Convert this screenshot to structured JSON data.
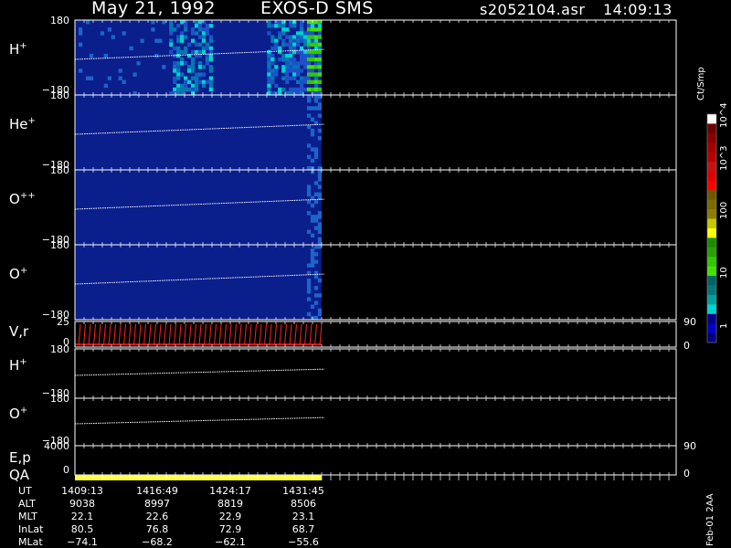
{
  "header": {
    "date": "May 21, 1992",
    "instrument": "EXOS-D SMS",
    "file": "s2052104.asr",
    "time": "14:09:13"
  },
  "panels": [
    {
      "ion": "H",
      "charge": "+",
      "ymax": "180",
      "ymin": "−180",
      "kind": "spectrogram",
      "fill_fraction": 0.36
    },
    {
      "ion": "He",
      "charge": "+",
      "ymax": "180",
      "ymin": "−180",
      "kind": "spectrogram",
      "fill_fraction": 0.36
    },
    {
      "ion": "O",
      "charge": "++",
      "ymax": "180",
      "ymin": "−180",
      "kind": "spectrogram",
      "fill_fraction": 0.36
    },
    {
      "ion": "O",
      "charge": "+",
      "ymax": "180",
      "ymin": "−180",
      "kind": "spectrogram",
      "fill_fraction": 0.36
    },
    {
      "label": "V,r",
      "ymax": "25",
      "ymin": "0",
      "rmax": "90",
      "rmin": "0",
      "kind": "vectors"
    },
    {
      "ion": "H",
      "charge": "+",
      "ymax": "180",
      "ymin": "−180",
      "kind": "line"
    },
    {
      "ion": "O",
      "charge": "+",
      "ymax": "180",
      "ymin": "−180",
      "kind": "line"
    },
    {
      "label": "E,p",
      "ymax": "4000",
      "ymin": "0",
      "rmax": "90",
      "rmin": "0",
      "kind": "empty"
    },
    {
      "label": "QA",
      "kind": "qa"
    }
  ],
  "colorbar": {
    "units": "Ct/Smp",
    "tick_labels": [
      "10^4",
      "10^3",
      "100",
      "10",
      "1"
    ],
    "colors": [
      "#ffffff",
      "#6b0000",
      "#8a0000",
      "#a40000",
      "#b80000",
      "#c81010",
      "#e00000",
      "#ff0000",
      "#6b5a00",
      "#7d6b00",
      "#8f7d00",
      "#c8c800",
      "#ffff00",
      "#1e8c00",
      "#28a000",
      "#32c800",
      "#46e000",
      "#006464",
      "#007878",
      "#00a0a0",
      "#00d2d2",
      "#00008c",
      "#0000c8",
      "#000080"
    ]
  },
  "table": {
    "columns": [
      "1409:13",
      "1416:49",
      "1424:17",
      "1431:45"
    ],
    "rows": [
      {
        "label": "UT",
        "values": [
          "1409:13",
          "1416:49",
          "1424:17",
          "1431:45"
        ]
      },
      {
        "label": "ALT",
        "values": [
          "9038",
          "8997",
          "8819",
          "8506"
        ]
      },
      {
        "label": "MLT",
        "values": [
          "22.1",
          "22.6",
          "22.9",
          "23.1"
        ]
      },
      {
        "label": "InLat",
        "values": [
          "80.5",
          "76.8",
          "72.9",
          "68.7"
        ]
      },
      {
        "label": "MLat",
        "values": [
          "−74.1",
          "−68.2",
          "−62.1",
          "−55.6"
        ]
      }
    ]
  },
  "side_label": "Feb-01 2AA",
  "colors": {
    "background": "#000000",
    "spectrogram_bg": "#0a1e8c",
    "trace": "#ffffff",
    "vectors": "#ff2020",
    "qa": "#ffff40"
  },
  "chart_data": {
    "type": "heatmap",
    "title": "May 21, 1992   EXOS-D SMS",
    "x_time_labels": [
      "1409:13",
      "1416:49",
      "1424:17",
      "1431:45"
    ],
    "series": [
      {
        "name": "H+"
      },
      {
        "name": "He+"
      },
      {
        "name": "O++"
      },
      {
        "name": "O+"
      }
    ],
    "ylim": [
      -180,
      180
    ],
    "data_coverage_fraction": 0.36
  }
}
